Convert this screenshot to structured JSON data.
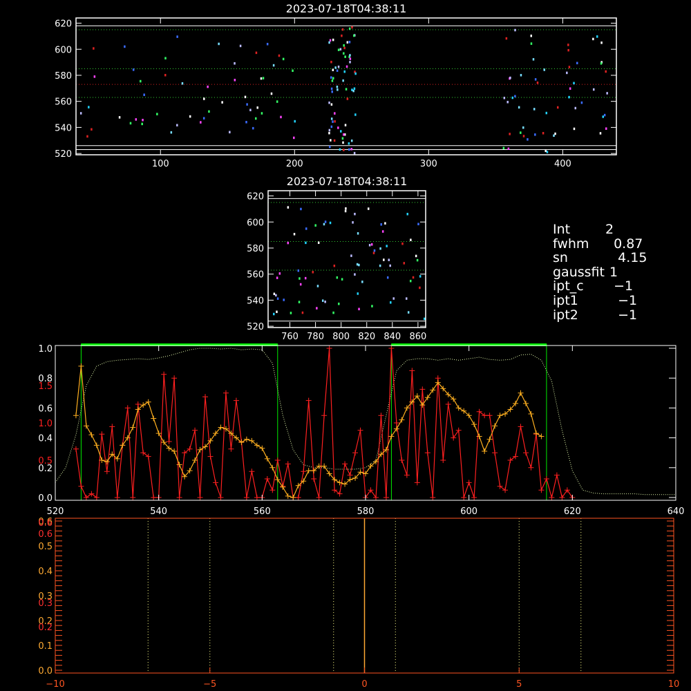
{
  "colors": {
    "background": "#000000",
    "axes": "#ffffff",
    "ref_green": "#33cc33",
    "ref_red": "#dd2222",
    "ref_white": "#ffffff",
    "window_green": "#00ee00",
    "red_series": "#ff2020",
    "orange_series": "#ffb020",
    "dotted_profile": "#e8ffb0",
    "bottom_axes": "#ff5522",
    "bottom_ylabels_yellow": "#ffaa33",
    "bottom_ylabels_red": "#ff3030",
    "bottom_vlines": "#ffff88",
    "bottom_center": "#ffaa33"
  },
  "info_panel": [
    {
      "key": "Int",
      "value": "2"
    },
    {
      "key": "fwhm",
      "value": "  0.87"
    },
    {
      "key": "sn",
      "value": "   4.15"
    },
    {
      "key": "gaussfit",
      "value": " 1"
    },
    {
      "key": "ipt_c",
      "value": "  −1"
    },
    {
      "key": "ipt1",
      "value": "   −1"
    },
    {
      "key": "ipt2",
      "value": "   −1"
    }
  ],
  "chart_data": [
    {
      "id": "top_image",
      "type": "heatmap",
      "title": "2023-07-18T04:38:11",
      "xlim": [
        37,
        440
      ],
      "ylim": [
        519,
        624
      ],
      "xticks": [
        100,
        200,
        300,
        400
      ],
      "yticks": [
        520,
        540,
        560,
        580,
        600,
        620
      ],
      "reference_lines": [
        {
          "y": 618,
          "color": "white",
          "style": "solid"
        },
        {
          "y": 615,
          "color": "green",
          "style": "dotted"
        },
        {
          "y": 585,
          "color": "green",
          "style": "dotted"
        },
        {
          "y": 573,
          "color": "red",
          "style": "dotted"
        },
        {
          "y": 563,
          "color": "green",
          "style": "dotted"
        },
        {
          "y": 526,
          "color": "white",
          "style": "solid"
        },
        {
          "y": 523,
          "color": "white",
          "style": "solid"
        }
      ],
      "pixel_clusters": [
        {
          "x_range": [
            40,
            200
          ],
          "y_range": [
            528,
            612
          ],
          "count": 55
        },
        {
          "x_range": [
            225,
            245
          ],
          "y_range": [
            520,
            618
          ],
          "count": 70
        },
        {
          "x_range": [
            355,
            435
          ],
          "y_range": [
            522,
            616
          ],
          "count": 55
        }
      ]
    },
    {
      "id": "zoom_image",
      "type": "heatmap",
      "title": "2023-07-18T04:38:11",
      "xlim": [
        743,
        866
      ],
      "ylim": [
        519,
        624
      ],
      "xticks": [
        760,
        780,
        800,
        820,
        840,
        860
      ],
      "yticks": [
        520,
        540,
        560,
        580,
        600,
        620
      ],
      "reference_lines": [
        {
          "y": 618,
          "color": "white",
          "style": "solid"
        },
        {
          "y": 615,
          "color": "green",
          "style": "dotted"
        },
        {
          "y": 585,
          "color": "green",
          "style": "dotted"
        },
        {
          "y": 563,
          "color": "green",
          "style": "dotted"
        },
        {
          "y": 524,
          "color": "white",
          "style": "solid"
        }
      ],
      "pixel_clusters": [
        {
          "x_range": [
            745,
            865
          ],
          "y_range": [
            521,
            614
          ],
          "count": 80
        }
      ]
    },
    {
      "id": "profile_plot",
      "type": "line",
      "xlim": [
        520,
        640
      ],
      "ylim_left_white": [
        0.0,
        1.0
      ],
      "ylim_left_red": [
        0.0,
        2.0
      ],
      "xticks": [
        520,
        540,
        560,
        580,
        600,
        620,
        640
      ],
      "yticks_white": [
        "0.0",
        "0.2",
        "0.4",
        "0.6",
        "0.8",
        "1.0"
      ],
      "yticks_red": [
        "0.5",
        "1.0",
        "1.5"
      ],
      "green_windows": [
        [
          525,
          563
        ],
        [
          585,
          615
        ]
      ],
      "series": [
        {
          "color": "dotted",
          "x": [
            520,
            522,
            524,
            526,
            528,
            530,
            532,
            534,
            536,
            538,
            540,
            542,
            544,
            546,
            548,
            550,
            552,
            554,
            556,
            558,
            560,
            562,
            564,
            566,
            568,
            570,
            572,
            574,
            576,
            578,
            580,
            582,
            584,
            586,
            588,
            590,
            592,
            594,
            596,
            598,
            600,
            602,
            604,
            606,
            608,
            610,
            612,
            614,
            616,
            618,
            620,
            622,
            624,
            626,
            628,
            630,
            632,
            634,
            636,
            638,
            640
          ],
          "y": [
            0.1,
            0.2,
            0.42,
            0.75,
            0.88,
            0.91,
            0.92,
            0.925,
            0.93,
            0.925,
            0.935,
            0.95,
            0.97,
            0.99,
            1.0,
            1.0,
            0.995,
            1.0,
            0.99,
            0.995,
            0.99,
            0.9,
            0.55,
            0.32,
            0.22,
            0.2,
            0.2,
            0.19,
            0.19,
            0.19,
            0.2,
            0.25,
            0.55,
            0.85,
            0.92,
            0.93,
            0.93,
            0.92,
            0.93,
            0.92,
            0.93,
            0.94,
            0.925,
            0.92,
            0.925,
            0.955,
            0.96,
            0.92,
            0.78,
            0.45,
            0.18,
            0.05,
            0.03,
            0.025,
            0.025,
            0.025,
            0.025,
            0.02,
            0.02,
            0.02,
            0.02
          ]
        },
        {
          "color": "red",
          "x": [
            524,
            525,
            526,
            527,
            528,
            529,
            530,
            531,
            532,
            533,
            534,
            535,
            536,
            537,
            538,
            539,
            540,
            541,
            542,
            543,
            544,
            545,
            546,
            547,
            548,
            549,
            550,
            551,
            552,
            553,
            554,
            555,
            556,
            557,
            558,
            559,
            560,
            561,
            562,
            563,
            564,
            565,
            566,
            567,
            568,
            569,
            570,
            571,
            572,
            573,
            574,
            575,
            576,
            577,
            578,
            579,
            580,
            581,
            582,
            583,
            584,
            585,
            586,
            587,
            588,
            589,
            590,
            591,
            592,
            593,
            594,
            595,
            596,
            597,
            598,
            599,
            600,
            601,
            602,
            603,
            604,
            605,
            606,
            607,
            608,
            609,
            610,
            611,
            612,
            613,
            614,
            615,
            616,
            617,
            618,
            619,
            620
          ],
          "y": [
            0.65,
            0.15,
            0.0,
            0.05,
            0.0,
            0.85,
            0.35,
            0.95,
            0.0,
            0.7,
            1.2,
            0.0,
            1.25,
            0.6,
            0.55,
            0.0,
            0.0,
            1.65,
            0.75,
            1.6,
            0.0,
            0.6,
            0.65,
            0.9,
            0.0,
            1.35,
            0.55,
            0.2,
            0.0,
            1.4,
            0.65,
            1.3,
            0.75,
            0.0,
            0.35,
            0.0,
            0.0,
            0.25,
            0.1,
            0.5,
            0.15,
            0.45,
            0.0,
            0.0,
            0.35,
            1.3,
            0.25,
            0.0,
            1.1,
            2.0,
            0.1,
            0.05,
            0.45,
            0.3,
            0.6,
            0.9,
            0.0,
            0.1,
            0.0,
            1.1,
            0.0,
            2.0,
            1.0,
            0.5,
            0.3,
            1.7,
            0.2,
            1.45,
            0.6,
            0.0,
            1.6,
            0.5,
            1.25,
            0.8,
            0.9,
            0.0,
            0.2,
            0.0,
            1.15,
            1.1,
            1.1,
            0.6,
            0.15,
            0.1,
            0.5,
            0.55,
            0.95,
            0.6,
            0.4,
            0.85,
            0.1,
            0.25,
            0.0,
            0.3,
            0.0,
            0.1,
            0.0
          ]
        },
        {
          "color": "orange",
          "x": [
            524,
            525,
            526,
            527,
            528,
            529,
            530,
            531,
            532,
            533,
            534,
            535,
            536,
            537,
            538,
            539,
            540,
            541,
            542,
            543,
            544,
            545,
            546,
            547,
            548,
            549,
            550,
            551,
            552,
            553,
            554,
            555,
            556,
            557,
            558,
            559,
            560,
            561,
            562,
            563,
            564,
            565,
            566,
            567,
            568,
            569,
            570,
            571,
            572,
            573,
            574,
            575,
            576,
            577,
            578,
            579,
            580,
            581,
            582,
            583,
            584,
            585,
            586,
            587,
            588,
            589,
            590,
            591,
            592,
            593,
            594,
            595,
            596,
            597,
            598,
            599,
            600,
            601,
            602,
            603,
            604,
            605,
            606,
            607,
            608,
            609,
            610,
            611,
            612,
            613,
            614
          ],
          "y": [
            0.55,
            0.88,
            0.48,
            0.42,
            0.35,
            0.25,
            0.24,
            0.29,
            0.26,
            0.35,
            0.4,
            0.47,
            0.59,
            0.62,
            0.64,
            0.53,
            0.43,
            0.37,
            0.33,
            0.31,
            0.22,
            0.14,
            0.18,
            0.25,
            0.32,
            0.34,
            0.38,
            0.43,
            0.47,
            0.46,
            0.43,
            0.4,
            0.37,
            0.39,
            0.38,
            0.35,
            0.33,
            0.26,
            0.2,
            0.12,
            0.07,
            0.01,
            0.0,
            0.08,
            0.11,
            0.18,
            0.18,
            0.21,
            0.21,
            0.16,
            0.12,
            0.1,
            0.09,
            0.12,
            0.13,
            0.17,
            0.16,
            0.21,
            0.24,
            0.29,
            0.32,
            0.41,
            0.46,
            0.52,
            0.6,
            0.64,
            0.68,
            0.62,
            0.67,
            0.72,
            0.77,
            0.73,
            0.69,
            0.66,
            0.6,
            0.58,
            0.55,
            0.49,
            0.41,
            0.31,
            0.39,
            0.48,
            0.55,
            0.56,
            0.59,
            0.63,
            0.7,
            0.63,
            0.56,
            0.43,
            0.41
          ]
        }
      ]
    },
    {
      "id": "bottom_plot",
      "type": "line",
      "xlim": [
        -10,
        10
      ],
      "ylim": [
        0.0,
        0.6
      ],
      "xticks": [
        "−10",
        "−5",
        "0",
        "5",
        "10"
      ],
      "yticks_yellow": [
        "0.0",
        "0.1",
        "0.2",
        "0.3",
        "0.4",
        "0.5",
        "0.6"
      ],
      "yticks_red": [
        "0.2",
        "0.3",
        "0.6",
        "0.6"
      ],
      "vertical_lines": [
        -7,
        -5,
        -1,
        1,
        5,
        7
      ],
      "center_line": 0
    }
  ]
}
